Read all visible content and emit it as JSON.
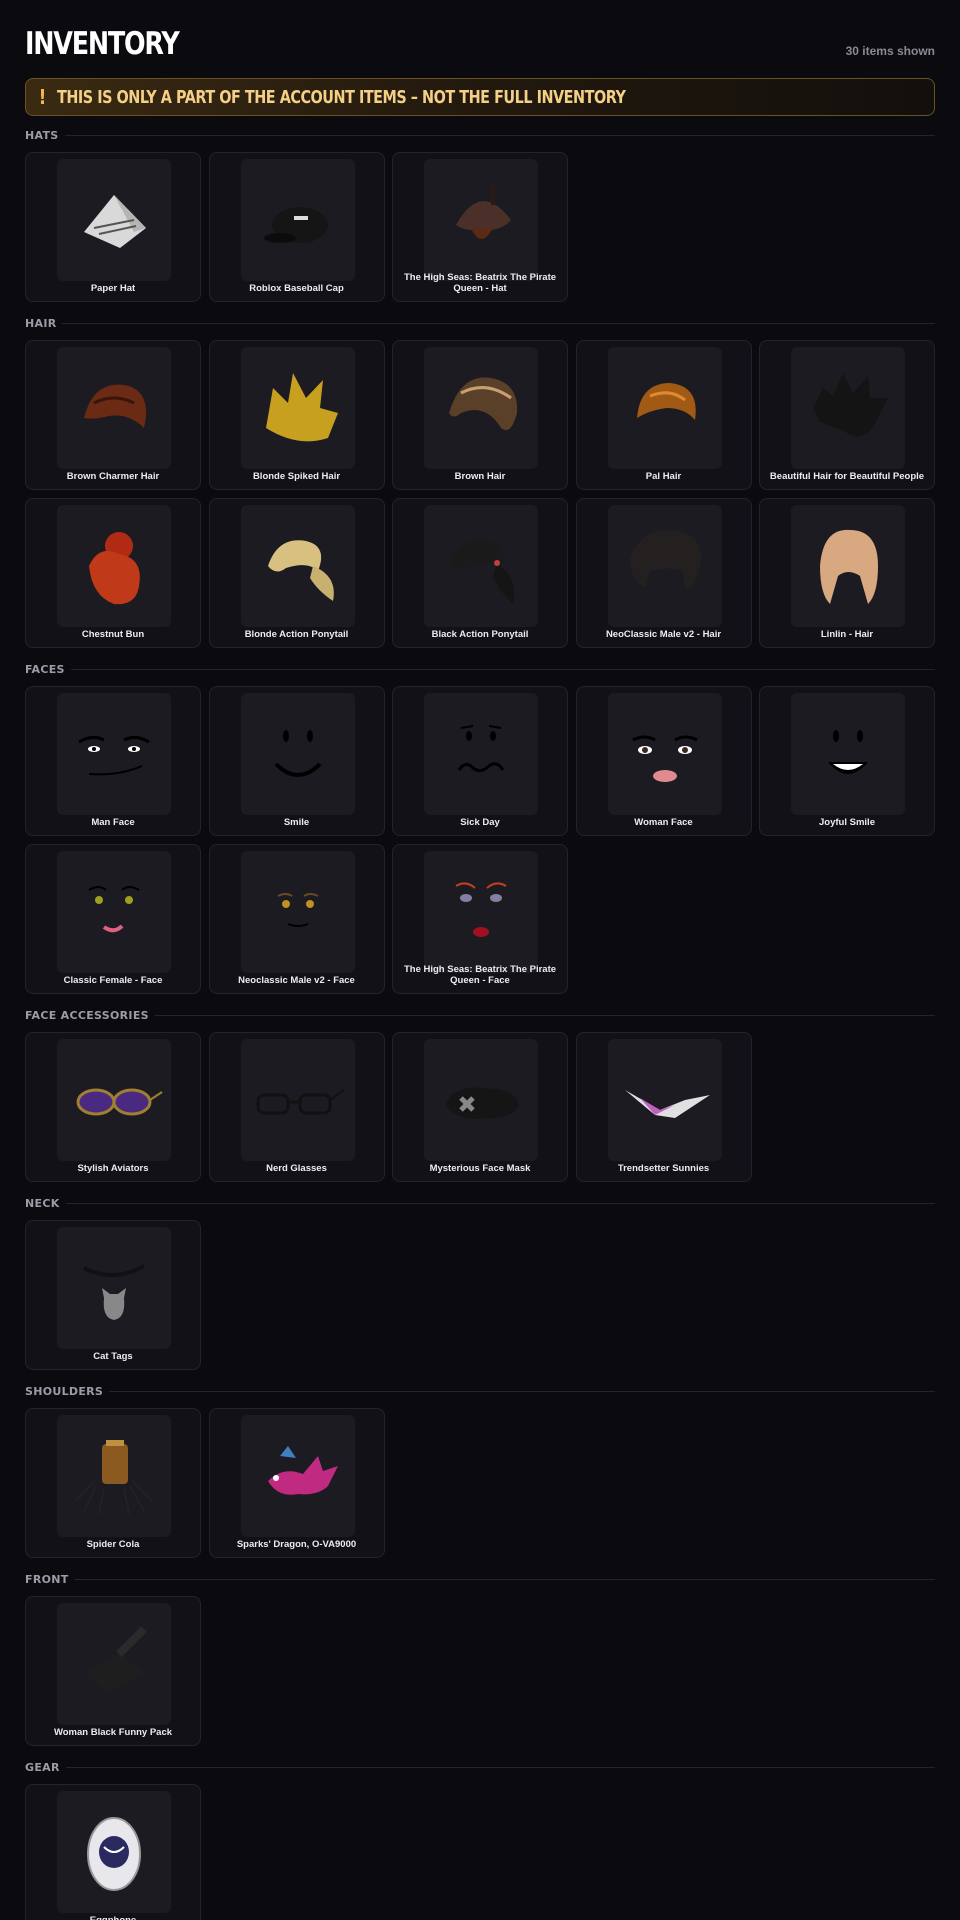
{
  "page": {
    "title": "INVENTORY",
    "items_shown": "30 items shown",
    "warning_icon": "!",
    "warning_text": "THIS IS ONLY A PART OF THE ACCOUNT ITEMS – NOT THE FULL INVENTORY"
  },
  "colors": {
    "background": "#0a0a0f",
    "warning_accent": "#f2b84b",
    "card": "#111117"
  },
  "sections": [
    {
      "label": "HATS",
      "items": [
        {
          "name": "Paper Hat",
          "icon": "paper-hat"
        },
        {
          "name": "Roblox Baseball Cap",
          "icon": "baseball-cap"
        },
        {
          "name": "The High Seas: Beatrix The Pirate Queen - Hat",
          "icon": "pirate-hat"
        }
      ]
    },
    {
      "label": "HAIR",
      "items": [
        {
          "name": "Brown Charmer Hair",
          "icon": "hair-brown-charmer"
        },
        {
          "name": "Blonde Spiked Hair",
          "icon": "hair-blonde-spiked"
        },
        {
          "name": "Brown Hair",
          "icon": "hair-brown"
        },
        {
          "name": "Pal Hair",
          "icon": "hair-pal"
        },
        {
          "name": "Beautiful Hair for Beautiful People",
          "icon": "hair-beautiful"
        },
        {
          "name": "Chestnut Bun",
          "icon": "hair-chestnut-bun"
        },
        {
          "name": "Blonde Action Ponytail",
          "icon": "hair-blonde-ponytail"
        },
        {
          "name": "Black Action Ponytail",
          "icon": "hair-black-ponytail"
        },
        {
          "name": "NeoClassic Male v2 - Hair",
          "icon": "hair-neoclassic"
        },
        {
          "name": "Linlin - Hair",
          "icon": "hair-linlin"
        }
      ]
    },
    {
      "label": "FACES",
      "items": [
        {
          "name": "Man Face",
          "icon": "face-man"
        },
        {
          "name": "Smile",
          "icon": "face-smile"
        },
        {
          "name": "Sick Day",
          "icon": "face-sick"
        },
        {
          "name": "Woman Face",
          "icon": "face-woman"
        },
        {
          "name": "Joyful Smile",
          "icon": "face-joyful"
        },
        {
          "name": "Classic Female - Face",
          "icon": "face-classic-female"
        },
        {
          "name": "Neoclassic Male v2 - Face",
          "icon": "face-neoclassic"
        },
        {
          "name": "The High Seas: Beatrix The Pirate Queen - Face",
          "icon": "face-pirate"
        }
      ]
    },
    {
      "label": "FACE ACCESSORIES",
      "items": [
        {
          "name": "Stylish Aviators",
          "icon": "aviators"
        },
        {
          "name": "Nerd Glasses",
          "icon": "nerd-glasses"
        },
        {
          "name": "Mysterious Face Mask",
          "icon": "face-mask"
        },
        {
          "name": "Trendsetter Sunnies",
          "icon": "sunnies"
        }
      ]
    },
    {
      "label": "NECK",
      "items": [
        {
          "name": "Cat Tags",
          "icon": "cat-tags"
        }
      ]
    },
    {
      "label": "SHOULDERS",
      "items": [
        {
          "name": "Spider Cola",
          "icon": "spider-cola"
        },
        {
          "name": "Sparks' Dragon, O-VA9000",
          "icon": "dragon"
        }
      ]
    },
    {
      "label": "FRONT",
      "items": [
        {
          "name": "Woman Black Funny Pack",
          "icon": "funny-pack"
        }
      ]
    },
    {
      "label": "GEAR",
      "items": [
        {
          "name": "Eggphone",
          "icon": "eggphone"
        }
      ]
    }
  ]
}
